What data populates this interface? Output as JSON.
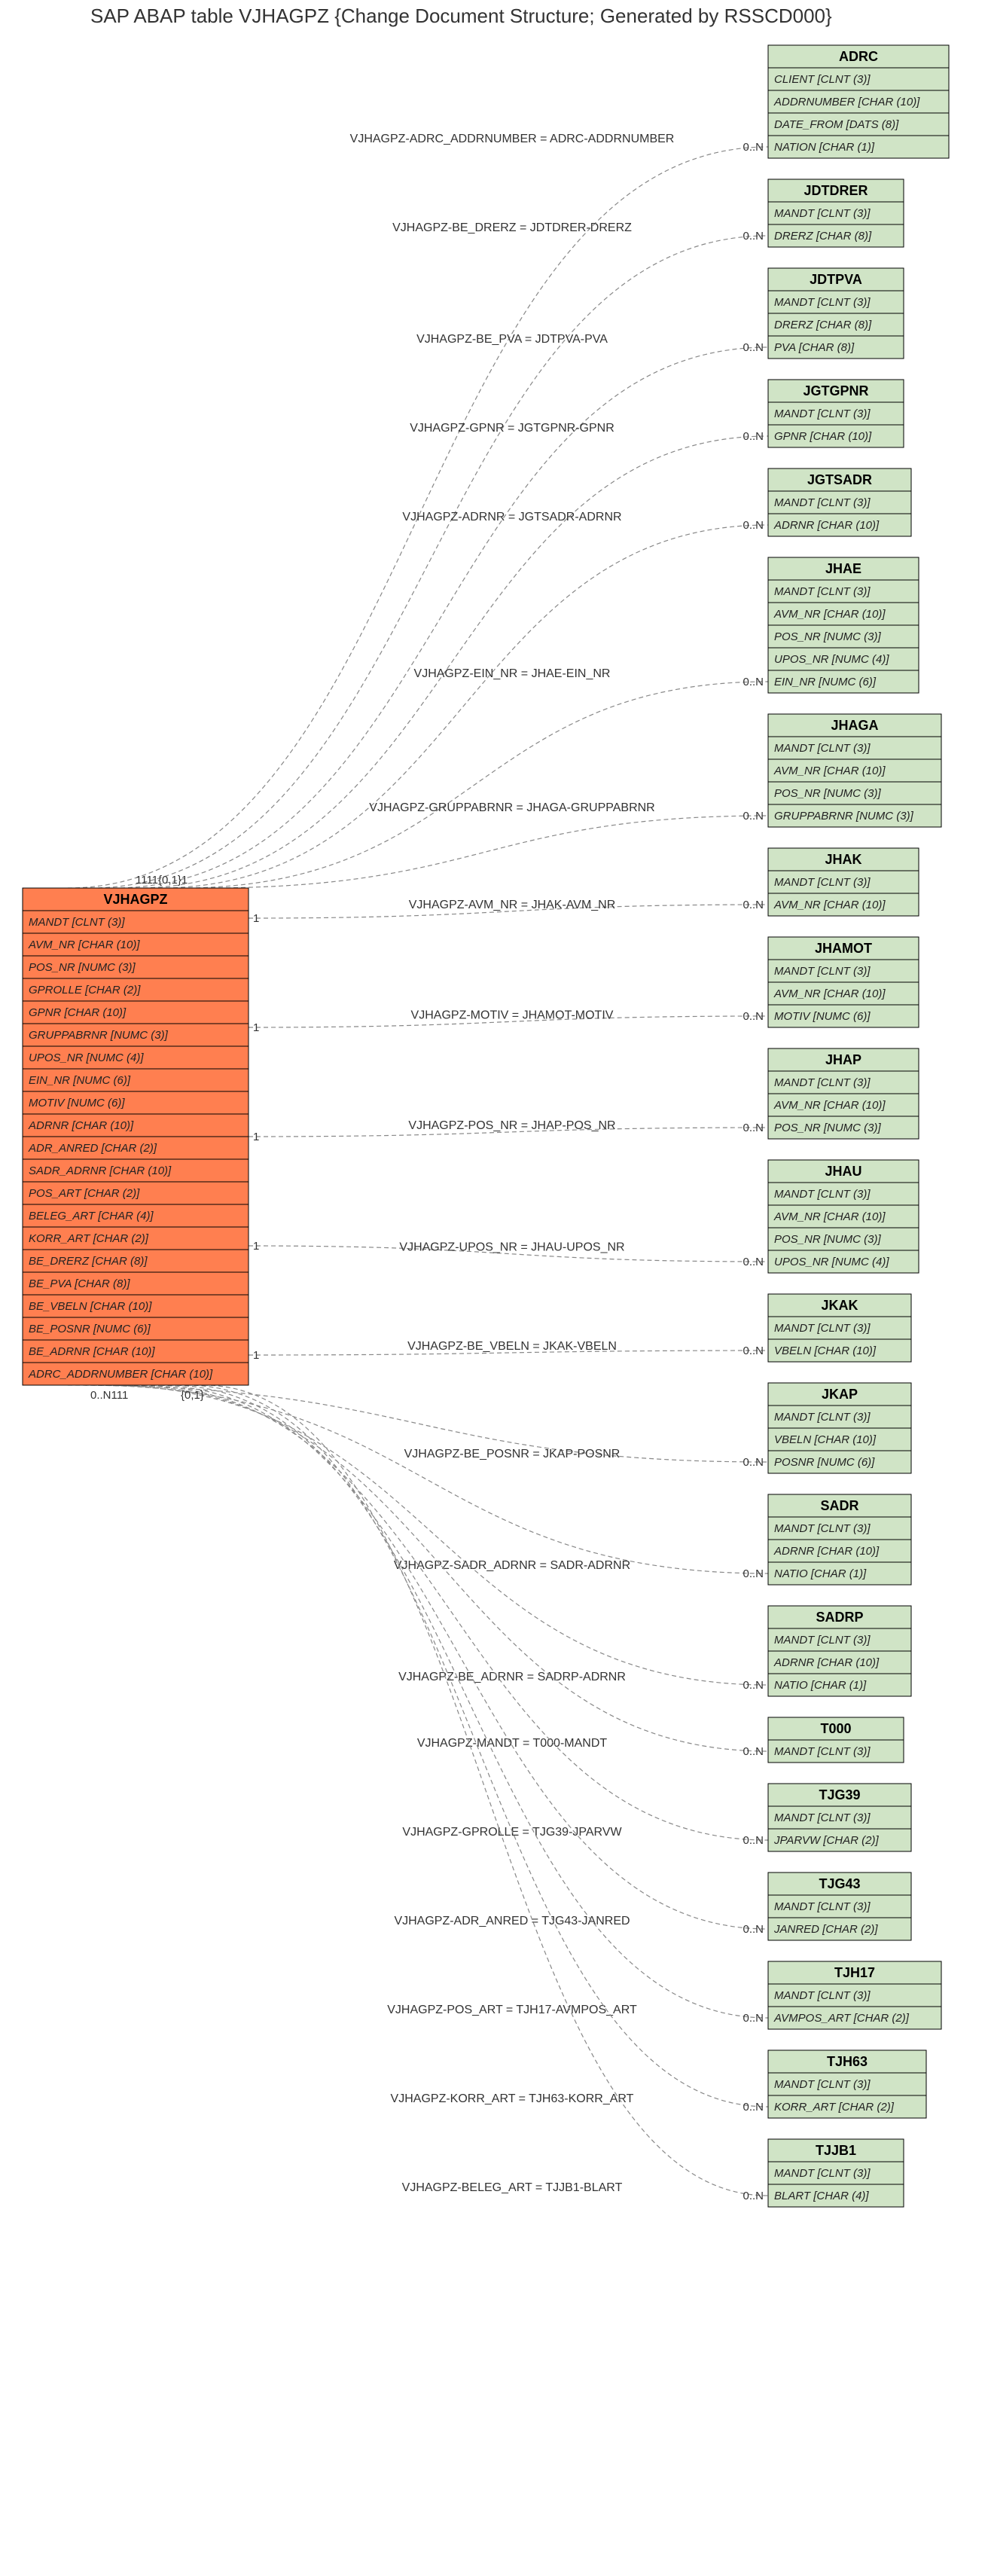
{
  "title": "SAP ABAP table VJHAGPZ {Change Document Structure; Generated by RSSCD000}",
  "mainTable": {
    "name": "VJHAGPZ",
    "fields": [
      "MANDT [CLNT (3)]",
      "AVM_NR [CHAR (10)]",
      "POS_NR [NUMC (3)]",
      "GPROLLE [CHAR (2)]",
      "GPNR [CHAR (10)]",
      "GRUPPABRNR [NUMC (3)]",
      "UPOS_NR [NUMC (4)]",
      "EIN_NR [NUMC (6)]",
      "MOTIV [NUMC (6)]",
      "ADRNR [CHAR (10)]",
      "ADR_ANRED [CHAR (2)]",
      "SADR_ADRNR [CHAR (10)]",
      "POS_ART [CHAR (2)]",
      "BELEG_ART [CHAR (4)]",
      "KORR_ART [CHAR (2)]",
      "BE_DRERZ [CHAR (8)]",
      "BE_PVA [CHAR (8)]",
      "BE_VBELN [CHAR (10)]",
      "BE_POSNR [NUMC (6)]",
      "BE_ADRNR [CHAR (10)]",
      "ADRC_ADDRNUMBER [CHAR (10)]"
    ]
  },
  "relations": [
    {
      "edge": "VJHAGPZ-ADRC_ADDRNUMBER = ADRC-ADDRNUMBER",
      "card": "0..N",
      "table": "ADRC",
      "fields": [
        "CLIENT [CLNT (3)]",
        "ADDRNUMBER [CHAR (10)]",
        "DATE_FROM [DATS (8)]",
        "NATION [CHAR (1)]"
      ]
    },
    {
      "edge": "VJHAGPZ-BE_DRERZ = JDTDRER-DRERZ",
      "card": "0..N",
      "table": "JDTDRER",
      "fields": [
        "MANDT [CLNT (3)]",
        "DRERZ [CHAR (8)]"
      ]
    },
    {
      "edge": "VJHAGPZ-BE_PVA = JDTPVA-PVA",
      "card": "0..N",
      "table": "JDTPVA",
      "fields": [
        "MANDT [CLNT (3)]",
        "DRERZ [CHAR (8)]",
        "PVA [CHAR (8)]"
      ]
    },
    {
      "edge": "VJHAGPZ-GPNR = JGTGPNR-GPNR",
      "card": "0..N",
      "table": "JGTGPNR",
      "fields": [
        "MANDT [CLNT (3)]",
        "GPNR [CHAR (10)]"
      ]
    },
    {
      "edge": "VJHAGPZ-ADRNR = JGTSADR-ADRNR",
      "card": "0..N",
      "table": "JGTSADR",
      "fields": [
        "MANDT [CLNT (3)]",
        "ADRNR [CHAR (10)]"
      ]
    },
    {
      "edge": "VJHAGPZ-EIN_NR = JHAE-EIN_NR",
      "card": "0..N",
      "table": "JHAE",
      "fields": [
        "MANDT [CLNT (3)]",
        "AVM_NR [CHAR (10)]",
        "POS_NR [NUMC (3)]",
        "UPOS_NR [NUMC (4)]",
        "EIN_NR [NUMC (6)]"
      ]
    },
    {
      "edge": "VJHAGPZ-GRUPPABRNR = JHAGA-GRUPPABRNR",
      "card": "0..N",
      "table": "JHAGA",
      "fields": [
        "MANDT [CLNT (3)]",
        "AVM_NR [CHAR (10)]",
        "POS_NR [NUMC (3)]",
        "GRUPPABRNR [NUMC (3)]"
      ]
    },
    {
      "edge": "VJHAGPZ-AVM_NR = JHAK-AVM_NR",
      "card": "0..N",
      "table": "JHAK",
      "fields": [
        "MANDT [CLNT (3)]",
        "AVM_NR [CHAR (10)]"
      ]
    },
    {
      "edge": "VJHAGPZ-MOTIV = JHAMOT-MOTIV",
      "card": "0..N",
      "table": "JHAMOT",
      "fields": [
        "MANDT [CLNT (3)]",
        "AVM_NR [CHAR (10)]",
        "MOTIV [NUMC (6)]"
      ]
    },
    {
      "edge": "VJHAGPZ-POS_NR = JHAP-POS_NR",
      "card": "0..N",
      "table": "JHAP",
      "fields": [
        "MANDT [CLNT (3)]",
        "AVM_NR [CHAR (10)]",
        "POS_NR [NUMC (3)]"
      ]
    },
    {
      "edge": "VJHAGPZ-UPOS_NR = JHAU-UPOS_NR",
      "card": "0..N",
      "table": "JHAU",
      "fields": [
        "MANDT [CLNT (3)]",
        "AVM_NR [CHAR (10)]",
        "POS_NR [NUMC (3)]",
        "UPOS_NR [NUMC (4)]"
      ]
    },
    {
      "edge": "VJHAGPZ-BE_VBELN = JKAK-VBELN",
      "card": "0..N",
      "table": "JKAK",
      "fields": [
        "MANDT [CLNT (3)]",
        "VBELN [CHAR (10)]"
      ]
    },
    {
      "edge": "VJHAGPZ-BE_POSNR = JKAP-POSNR",
      "card": "0..N",
      "table": "JKAP",
      "fields": [
        "MANDT [CLNT (3)]",
        "VBELN [CHAR (10)]",
        "POSNR [NUMC (6)]"
      ]
    },
    {
      "edge": "VJHAGPZ-SADR_ADRNR = SADR-ADRNR",
      "card": "0..N",
      "table": "SADR",
      "fields": [
        "MANDT [CLNT (3)]",
        "ADRNR [CHAR (10)]",
        "NATIO [CHAR (1)]"
      ]
    },
    {
      "edge": "VJHAGPZ-BE_ADRNR = SADRP-ADRNR",
      "card": "0..N",
      "table": "SADRP",
      "fields": [
        "MANDT [CLNT (3)]",
        "ADRNR [CHAR (10)]",
        "NATIO [CHAR (1)]"
      ]
    },
    {
      "edge": "VJHAGPZ-MANDT = T000-MANDT",
      "card": "0..N",
      "table": "T000",
      "fields": [
        "MANDT [CLNT (3)]"
      ]
    },
    {
      "edge": "VJHAGPZ-GPROLLE = TJG39-JPARVW",
      "card": "0..N",
      "table": "TJG39",
      "fields": [
        "MANDT [CLNT (3)]",
        "JPARVW [CHAR (2)]"
      ]
    },
    {
      "edge": "VJHAGPZ-ADR_ANRED = TJG43-JANRED",
      "card": "0..N",
      "table": "TJG43",
      "fields": [
        "MANDT [CLNT (3)]",
        "JANRED [CHAR (2)]"
      ]
    },
    {
      "edge": "VJHAGPZ-POS_ART = TJH17-AVMPOS_ART",
      "card": "0..N",
      "table": "TJH17",
      "fields": [
        "MANDT [CLNT (3)]",
        "AVMPOS_ART [CHAR (2)]"
      ]
    },
    {
      "edge": "VJHAGPZ-KORR_ART = TJH63-KORR_ART",
      "card": "0..N",
      "table": "TJH63",
      "fields": [
        "MANDT [CLNT (3)]",
        "KORR_ART [CHAR (2)]"
      ]
    },
    {
      "edge": "VJHAGPZ-BELEG_ART = TJJB1-BLART",
      "card": "0..N",
      "table": "TJJB1",
      "fields": [
        "MANDT [CLNT (3)]",
        "BLART [CHAR (4)]"
      ]
    }
  ],
  "leftCard": "{0,1}",
  "topCardCluster": "1111{0,1}1",
  "bottomCardCluster": "0..N111"
}
